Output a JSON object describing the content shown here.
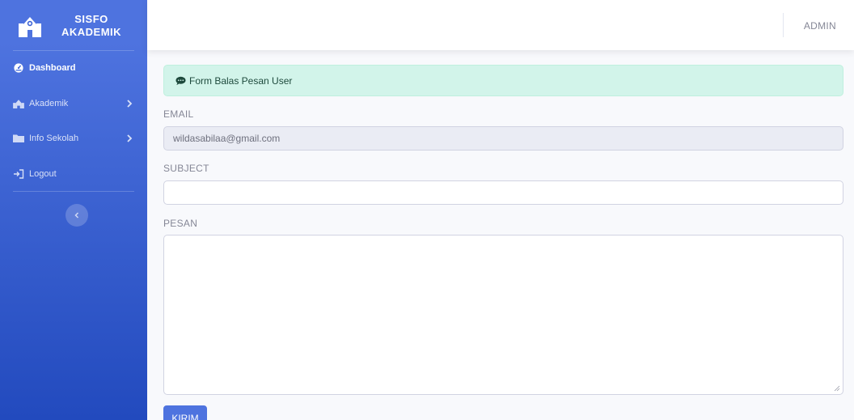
{
  "brand": {
    "line1": "SISFO",
    "line2": "AKADEMIK",
    "icon": "school-icon"
  },
  "sidebar": {
    "items": [
      {
        "label": "Dashboard",
        "icon": "dashboard-icon",
        "active": true
      },
      {
        "label": "Akademik",
        "icon": "school-icon",
        "has_submenu": true
      },
      {
        "label": "Info Sekolah",
        "icon": "folder-icon",
        "has_submenu": true
      },
      {
        "label": "Logout",
        "icon": "sign-out-icon"
      }
    ],
    "toggle_icon": "chevron-left-icon"
  },
  "topbar": {
    "user": "ADMIN"
  },
  "alert": {
    "text": "Form Balas Pesan User",
    "icon": "comment-icon"
  },
  "form": {
    "email_label": "EMAIL",
    "email_value": "wildasabilaa@gmail.com",
    "subject_label": "SUBJECT",
    "subject_value": "",
    "pesan_label": "PESAN",
    "submit_label": "KIRIM"
  },
  "colors": {
    "primary": "#4e73df",
    "primary_dark": "#224abe",
    "alert_bg": "#d2f4ea",
    "page_bg": "#f8f9fc"
  }
}
